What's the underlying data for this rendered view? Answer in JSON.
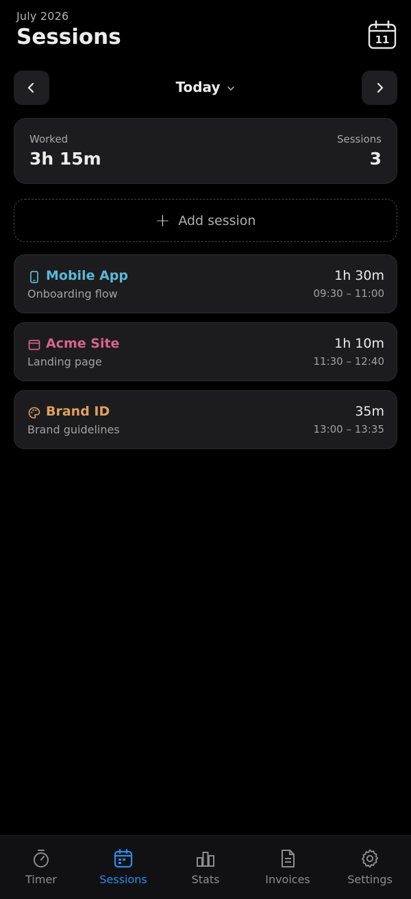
{
  "header": {
    "month": "July 2026",
    "title": "Sessions",
    "calendar_day": "11"
  },
  "period": {
    "label": "Today"
  },
  "summary": {
    "worked_label": "Worked",
    "worked_value": "3h 15m",
    "sessions_label": "Sessions",
    "sessions_value": "3"
  },
  "add_session": {
    "label": "Add session"
  },
  "sessions": [
    {
      "project": "Mobile App",
      "task": "Onboarding flow",
      "duration": "1h 30m",
      "range": "09:30 – 11:00",
      "color": "#5bb8d6",
      "icon": "phone-icon"
    },
    {
      "project": "Acme Site",
      "task": "Landing page",
      "duration": "1h 10m",
      "range": "11:30 – 12:40",
      "color": "#d9638f",
      "icon": "browser-window-icon"
    },
    {
      "project": "Brand ID",
      "task": "Brand guidelines",
      "duration": "35m",
      "range": "13:00 – 13:35",
      "color": "#e0a060",
      "icon": "palette-icon"
    }
  ],
  "tabs": [
    {
      "label": "Timer",
      "icon": "stopwatch-icon",
      "active": false
    },
    {
      "label": "Sessions",
      "icon": "calendar-icon",
      "active": true
    },
    {
      "label": "Stats",
      "icon": "bar-chart-icon",
      "active": false
    },
    {
      "label": "Invoices",
      "icon": "document-icon",
      "active": false
    },
    {
      "label": "Settings",
      "icon": "gear-icon",
      "active": false
    }
  ],
  "colors": {
    "accent": "#2d8cf0",
    "background": "#000000",
    "card": "#1c1c1e"
  }
}
